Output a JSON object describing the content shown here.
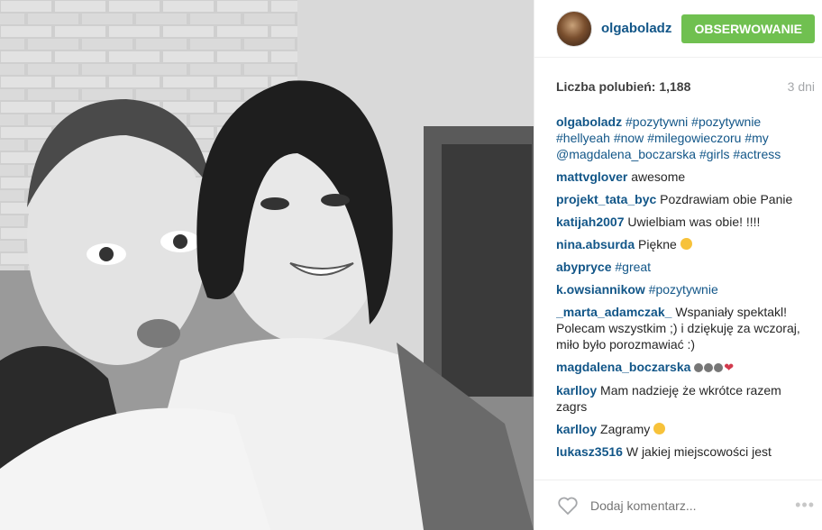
{
  "post": {
    "username": "olgaboladz",
    "follow_label": "OBSERWOWANIE",
    "likes_label": "Liczba polubień: 1,188",
    "time_ago": "3 dni",
    "add_comment_placeholder": "Dodaj komentarz...",
    "more_label": "•••"
  },
  "comments": [
    {
      "user": "olgaboladz",
      "parts": [
        "#pozytywni",
        "#pozytywnie",
        "#hellyeah",
        "#now",
        "#milegowieczoru",
        "#my",
        "@magdalena_boczarska",
        "#girls",
        "#actress"
      ]
    },
    {
      "user": "mattvglover",
      "text": "awesome"
    },
    {
      "user": "projekt_tata_byc",
      "text": "Pozdrawiam obie Panie"
    },
    {
      "user": "katijah2007",
      "text": "Uwielbiam was obie! !!!!"
    },
    {
      "user": "nina.absurda",
      "text": "Piękne"
    },
    {
      "user": "abypryce",
      "text": "#great"
    },
    {
      "user": "k.owsiannikow",
      "text": "#pozytywnie"
    },
    {
      "user": "_marta_adamczak_",
      "text": "Wspaniały spektakl! Polecam wszystkim ;) i dziękuję za wczoraj, miło było porozmawiać :)"
    },
    {
      "user": "magdalena_boczarska",
      "text": ""
    },
    {
      "user": "karlloy",
      "text": "Mam nadzieję że wkrótce razem zagrs"
    },
    {
      "user": "karlloy",
      "text": "Zagramy"
    },
    {
      "user": "lukasz3516",
      "text": "W jakiej miejscowości jest"
    }
  ],
  "colors": {
    "link": "#125688",
    "follow": "#70c050",
    "muted": "#a5a7aa"
  }
}
